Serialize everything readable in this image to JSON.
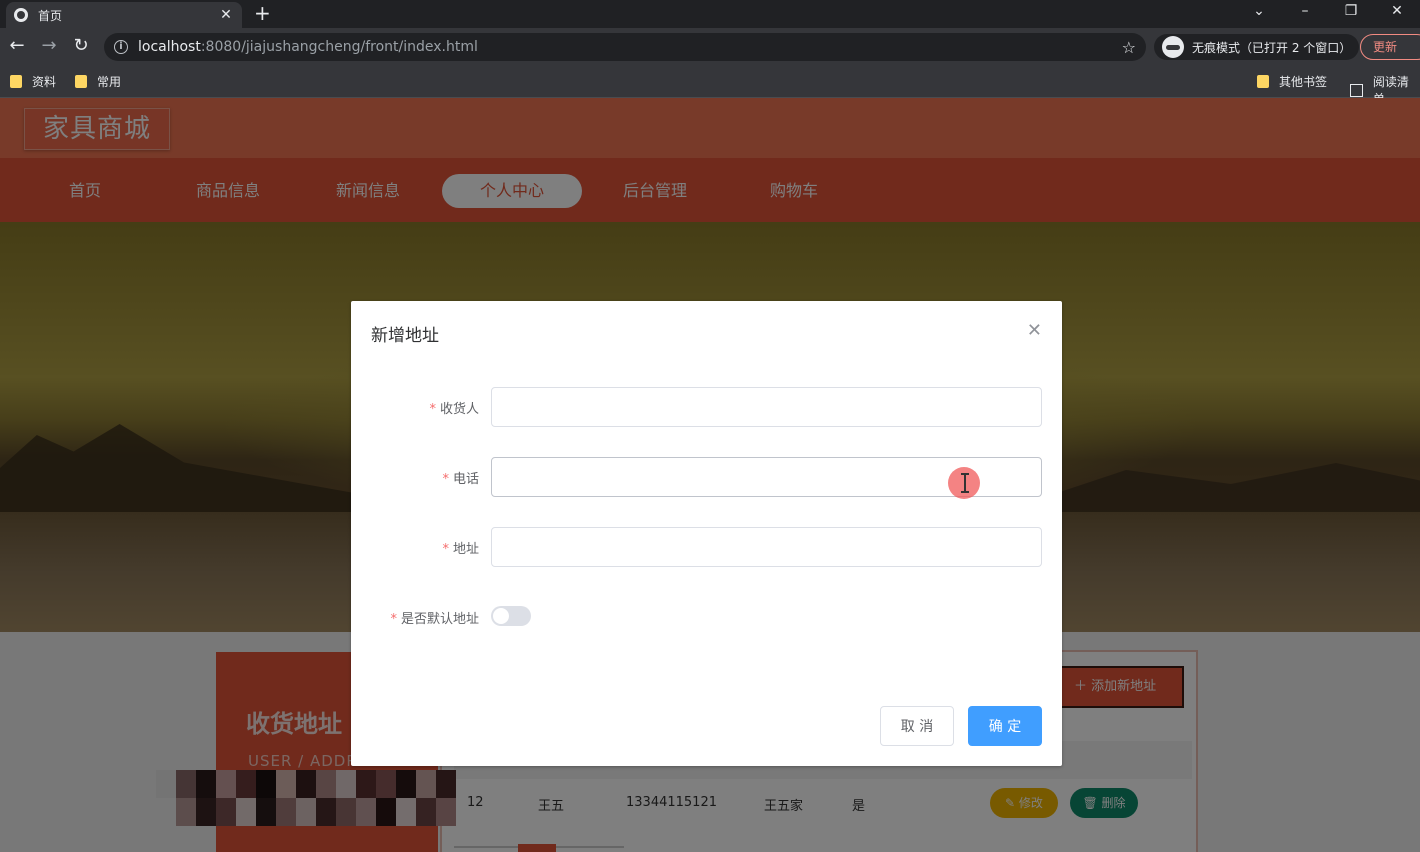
{
  "browser": {
    "tab_title": "首页",
    "url_host": "localhost",
    "url_rest": ":8080/jiajushangcheng/front/index.html",
    "incognito_label": "无痕模式（已打开 2 个窗口）",
    "update_label": "更新",
    "bookmarks": [
      "资料",
      "常用",
      "其他书签",
      "阅读清单"
    ]
  },
  "site": {
    "logo": "家具商城",
    "nav": [
      "首页",
      "商品信息",
      "新闻信息",
      "个人中心",
      "后台管理",
      "购物车"
    ],
    "active_nav": "个人中心"
  },
  "address_page": {
    "title": "收货地址",
    "subtitle": "USER / ADDRESS",
    "add_button": "添加新地址",
    "row": {
      "id": "12",
      "name": "王五",
      "phone": "13344115121",
      "address": "王五家",
      "is_default": "是"
    },
    "edit_label": "修改",
    "delete_label": "删除"
  },
  "dialog": {
    "title": "新增地址",
    "fields": [
      {
        "label": "收货人",
        "value": ""
      },
      {
        "label": "电话",
        "value": ""
      },
      {
        "label": "地址",
        "value": ""
      }
    ],
    "switch_label": "是否默认地址",
    "switch_on": false,
    "cancel_label": "取 消",
    "ok_label": "确 定"
  },
  "colors": {
    "header": "#f07452",
    "nav": "#e25538",
    "primary": "#409eff",
    "required": "#f56c6c"
  }
}
